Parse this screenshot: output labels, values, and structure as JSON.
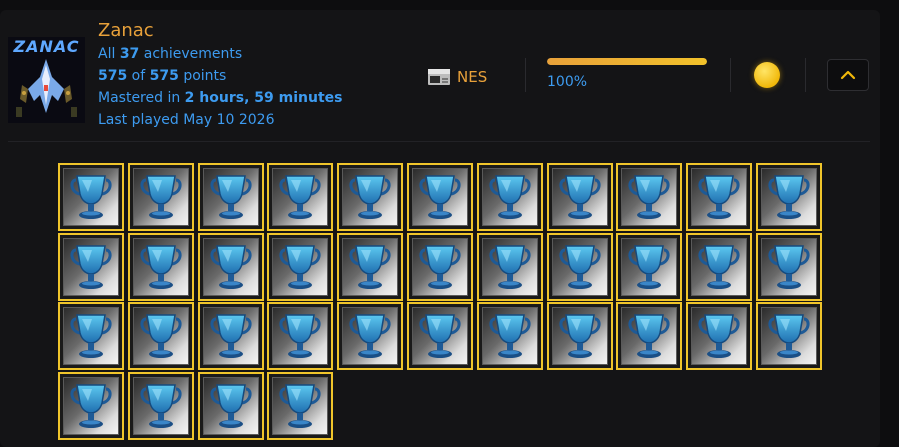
{
  "game": {
    "title": "Zanac",
    "badge_logo_text": "ZANAC",
    "platform": "NES",
    "achievements_line": {
      "pre": "All ",
      "count": "37",
      "post": " achievements"
    },
    "points_line": {
      "earned": "575",
      "mid": " of ",
      "total": "575",
      "post": " points"
    },
    "mastered_line": {
      "pre": "Mastered in ",
      "time": "2 hours, 59 minutes"
    },
    "last_played": "Last played May 10 2026",
    "progress_percent": 100,
    "progress_label": "100%",
    "status": "mastered"
  },
  "icons": {
    "platform_icon": "nes-console-icon",
    "mastery_icon": "gold-mastery-circle-icon",
    "toggle_icon": "chevron-up-icon",
    "achievement_icon": "trophy-icon"
  },
  "colors": {
    "title": "#e8a13a",
    "link": "#3d9bf0",
    "achievement_border": "#f0c52b",
    "mastery": "#f1b80a"
  },
  "achievements": {
    "total": 37,
    "unlocked": 37
  }
}
